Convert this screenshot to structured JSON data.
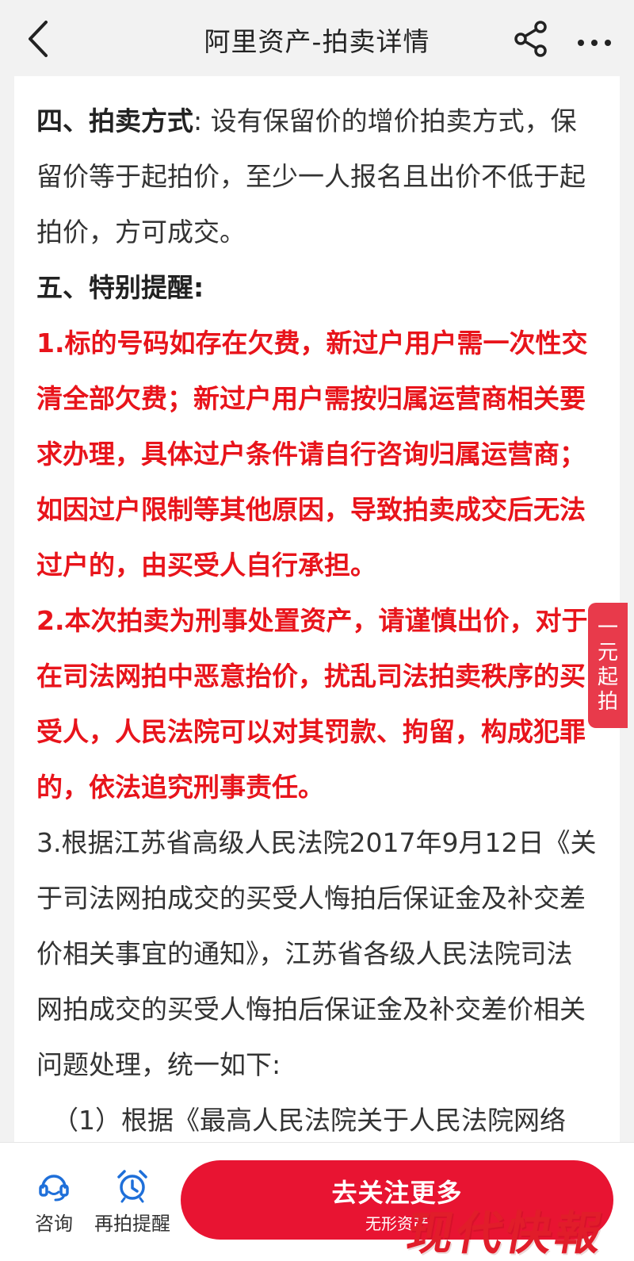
{
  "nav": {
    "title": "阿里资产-拍卖详情",
    "back_icon": "chevron-left-icon",
    "share_icon": "share-icon",
    "more_icon": "more-dots-icon"
  },
  "content": {
    "section4_lead": "四、拍卖方式",
    "section4_text": ": 设有保留价的增价拍卖方式，保留价等于起拍价，至少一人报名且出价不低于起拍价，方可成交。",
    "section5_head": "五、特别提醒:",
    "item1": "1.标的号码如存在欠费，新过户用户需一次性交清全部欠费；新过户用户需按归属运营商相关要求办理，具体过户条件请自行咨询归属运营商；如因过户限制等其他原因，导致拍卖成交后无法过户的，由买受人自行承担。",
    "item2": "2.本次拍卖为刑事处置资产，请谨慎出价，对于在司法网拍中恶意抬价，扰乱司法拍卖秩序的买受人，人民法院可以对其罚款、拘留，构成犯罪的，依法追究刑事责任。",
    "item3": "3.根据江苏省高级人民法院2017年9月12日《关于司法网拍成交的买受人悔拍后保证金及补交差价相关事宜的通知》，江苏省各级人民法院司法网拍成交的买受人悔拍后保证金及补交差价相关问题处理，统一如下:",
    "item3_sub1": "（1）根据《最高人民法院关于人民法院网络"
  },
  "side_tab": {
    "label": "一元起拍"
  },
  "bottom_bar": {
    "consult_label": "咨询",
    "remind_label": "再拍提醒",
    "cta_label": "去关注更多",
    "cta_sub": "无形资产"
  },
  "watermark": {
    "text": "现代快報"
  },
  "colors": {
    "accent_red": "#e8141b",
    "cta_red": "#e81432",
    "side_tab_red": "#e83a4b",
    "icon_blue": "#1e6fd9"
  }
}
